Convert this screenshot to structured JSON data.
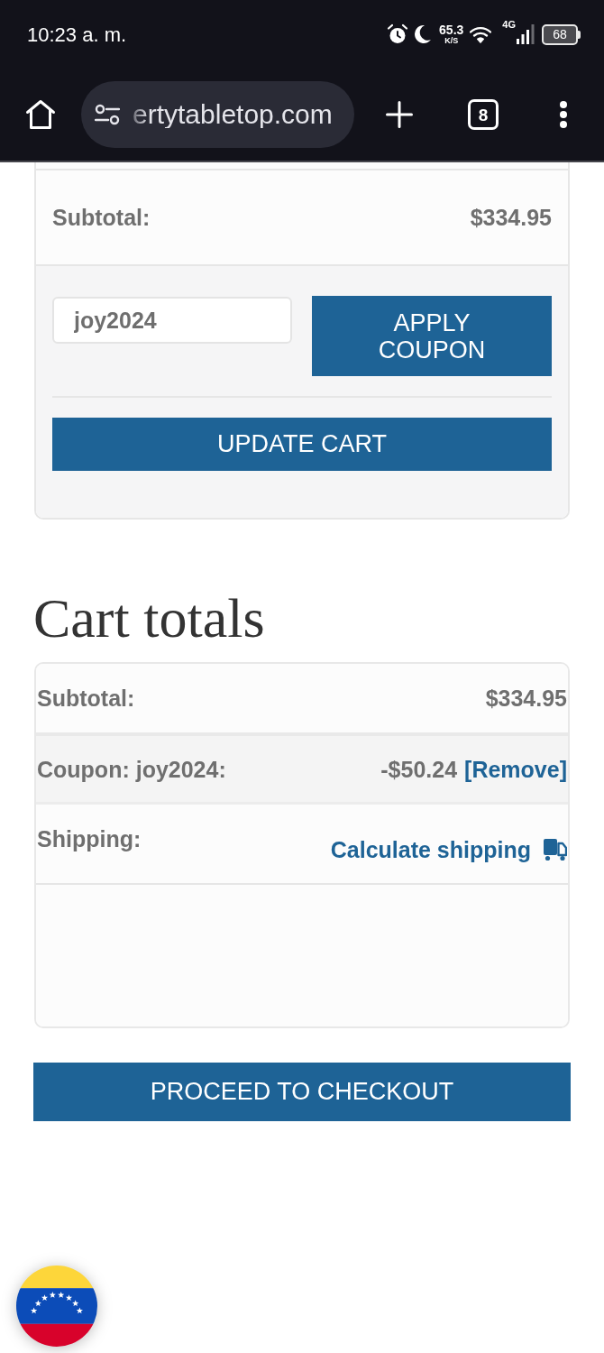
{
  "status_bar": {
    "time": "10:23 a. m.",
    "net_speed": "65.3",
    "net_unit": "K/S",
    "network": "4G",
    "battery": "68"
  },
  "browser": {
    "url": "ertytabletop.com",
    "tab_count": "8"
  },
  "cart_form": {
    "subtotal_label": "Subtotal:",
    "subtotal_value": "$334.95",
    "coupon_field": {
      "value": "joy2024"
    },
    "apply_button": "APPLY COUPON",
    "update_button": "UPDATE CART"
  },
  "cart_totals": {
    "title": "Cart totals",
    "rows": [
      {
        "kind": "amount",
        "label": "Subtotal:",
        "value": "$334.95"
      },
      {
        "kind": "coupon",
        "label": "Coupon: joy2024:",
        "value": "-$50.24",
        "link": "[Remove]"
      },
      {
        "kind": "shipping",
        "label": "Shipping:",
        "link": "Calculate shipping"
      }
    ],
    "checkout_button": "PROCEED TO CHECKOUT"
  }
}
